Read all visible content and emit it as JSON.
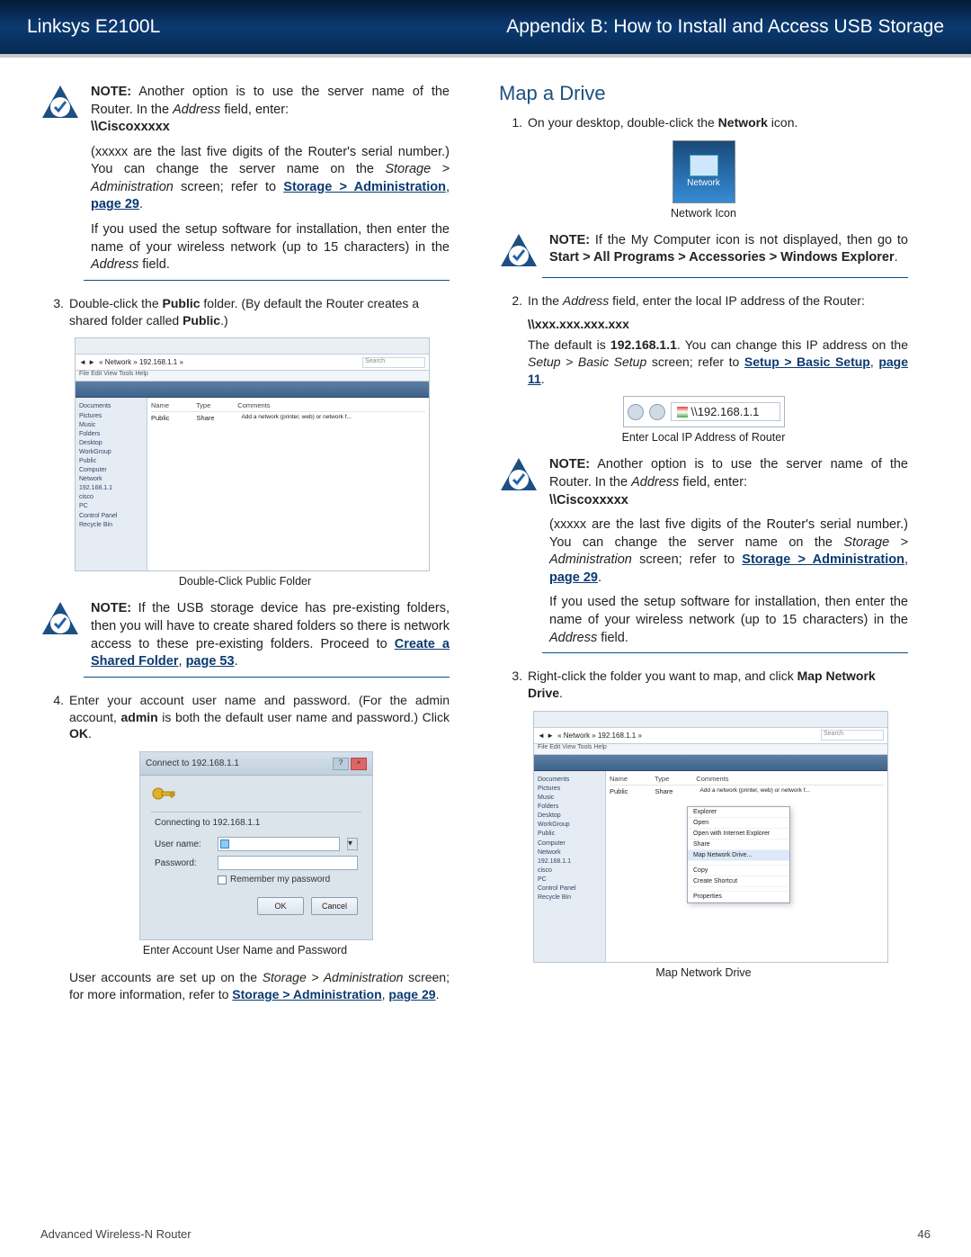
{
  "header": {
    "left": "Linksys E2100L",
    "right": "Appendix B: How to Install and Access USB Storage"
  },
  "left": {
    "note1": {
      "lead": "NOTE:",
      "t1": " Another option is to use the server name of the Router. In the ",
      "i1": "Address",
      "t2": " field, enter:",
      "bold1": "\\\\Ciscoxxxxx",
      "p2": "(xxxxx are the last five digits of the Router's serial number.) You can change the server name on the ",
      "i2": "Storage > Administration",
      "p2b": " screen; refer to ",
      "link1": "Storage > Administration",
      "comma1": ", ",
      "link1b": "page 29",
      "dot1": ".",
      "p3a": "If you used the setup software for installation, then enter the name of your wireless network (up to 15 characters) in the ",
      "i3": "Address",
      "p3b": " field."
    },
    "step3": {
      "num": "3.",
      "a": "Double-click the ",
      "b": "Public",
      "c": " folder. (By default the Router creates a shared folder called ",
      "d": "Public",
      "e": ".)"
    },
    "shotA": {
      "menu": "File  Edit  View  Tools  Help",
      "col1": "Name",
      "col2": "Type",
      "col3": "Comments",
      "row1": "Public",
      "row1v": "Share",
      "cmt": "Add a network (printer, web) or network f...",
      "search": "Search",
      "addr": "« Network » 192.168.1.1 »",
      "nav": [
        "Documents",
        "Pictures",
        "Music",
        "",
        "Folders",
        "Desktop",
        "WorkGroup",
        "Public",
        "Computer",
        "Network",
        "192.168.1.1",
        "cisco",
        "PC",
        "Control Panel",
        "Recycle Bin"
      ]
    },
    "shotA_label": "Double-Click Public Folder",
    "note2": {
      "lead": "NOTE:",
      "t1": " If the USB storage device has pre-existing folders, then you will have to create shared folders so there is network access to these pre-existing folders. Proceed to ",
      "link": "Create a Shared Folder",
      "comma": ", ",
      "linkb": "page 53",
      "dot": "."
    },
    "step4": {
      "num": "4.",
      "a": "Enter your account user name and password. (For the admin account, ",
      "b": "admin",
      "c": " is both the default user name and password.)  Click ",
      "d": "OK",
      "e": "."
    },
    "shotB": {
      "title": "Connect to 192.168.1.1",
      "conn": "Connecting to 192.168.1.1",
      "user": "User name:",
      "pass": "Password:",
      "rem": "Remember my password",
      "ok": "OK",
      "cancel": "Cancel"
    },
    "shotB_label": "Enter Account User Name and Password",
    "para": {
      "a": "User accounts are set up on the ",
      "i": "Storage > Administration",
      "b": " screen; for more information, refer to "
    },
    "para_link": "Storage > Administration",
    "para_comma": ", ",
    "para_linkb": "page 29",
    "para_dot": "."
  },
  "right": {
    "h2": "Map a Drive",
    "step1": {
      "num": "1.",
      "a": "On your desktop, double-click the ",
      "b": "Network",
      "c": " icon."
    },
    "netlabel": "Network",
    "shotSmall_label": "Network Icon",
    "note3": {
      "lead": "NOTE:",
      "t1": " If the My Computer icon is not displayed, then go to ",
      "b": "Start > All Programs > Accessories > Windows Explorer",
      "dot": "."
    },
    "step2": {
      "num": "2.",
      "a": "In the ",
      "i": "Address",
      "b": " field, enter the local IP address of the Router:"
    },
    "ip_bold": "\\\\xxx.xxx.xxx.xxx",
    "ip_p": {
      "a": "The default is ",
      "b": "192.168.1.1",
      "c": ". You can change this IP address on the ",
      "i": "Setup > Basic Setup",
      "d": " screen; refer to "
    },
    "ip_link": "Setup > Basic Setup",
    "ip_comma": ", ",
    "ip_linkb": "page 11",
    "ip_dot": ".",
    "ip_addr": "\\\\192.168.1.1",
    "shotIP_label": "Enter Local IP Address of Router",
    "note4": {
      "lead": "NOTE:",
      "t1": " Another option is to use the server name of the Router. In the ",
      "i1": "Address",
      "t2": " field, enter:",
      "bold1": "\\\\Ciscoxxxxx",
      "p2": "(xxxxx are the last five digits of the Router's serial number.) You can change the server name on the ",
      "i2": "Storage > Administration",
      "p2b": " screen; refer to ",
      "link1": "Storage > Administration",
      "comma1": ", ",
      "link1b": "page 29",
      "dot1": ".",
      "p3a": "If you used the setup software for installation, then enter the name of your wireless network (up to 15 characters) in the ",
      "i3": "Address",
      "p3b": " field."
    },
    "step3r": {
      "num": "3.",
      "a": "Right-click the folder you want to map, and click ",
      "b": "Map Network Drive",
      "c": "."
    },
    "shotC": {
      "menu": "File  Edit  View  Tools  Help",
      "col1": "Name",
      "col2": "Type",
      "col3": "Comments",
      "row1": "Public",
      "row1v": "Share",
      "cmt": "Add a network (printer, web) or network f...",
      "search": "Search",
      "addr": "« Network » 192.168.1.1 »",
      "ctx": [
        "Explorer",
        "Open",
        "Open with Internet Explorer",
        "Share",
        "Map Network Drive...",
        "",
        "Copy",
        "Create Shortcut",
        "",
        "Properties"
      ],
      "nav": [
        "Documents",
        "Pictures",
        "Music",
        "",
        "Folders",
        "Desktop",
        "WorkGroup",
        "Public",
        "Computer",
        "Network",
        "192.168.1.1",
        "cisco",
        "PC",
        "Control Panel",
        "Recycle Bin"
      ]
    },
    "shotC_label": "Map Network Drive"
  },
  "footer": {
    "left": "Advanced Wireless-N Router",
    "right": "46"
  }
}
